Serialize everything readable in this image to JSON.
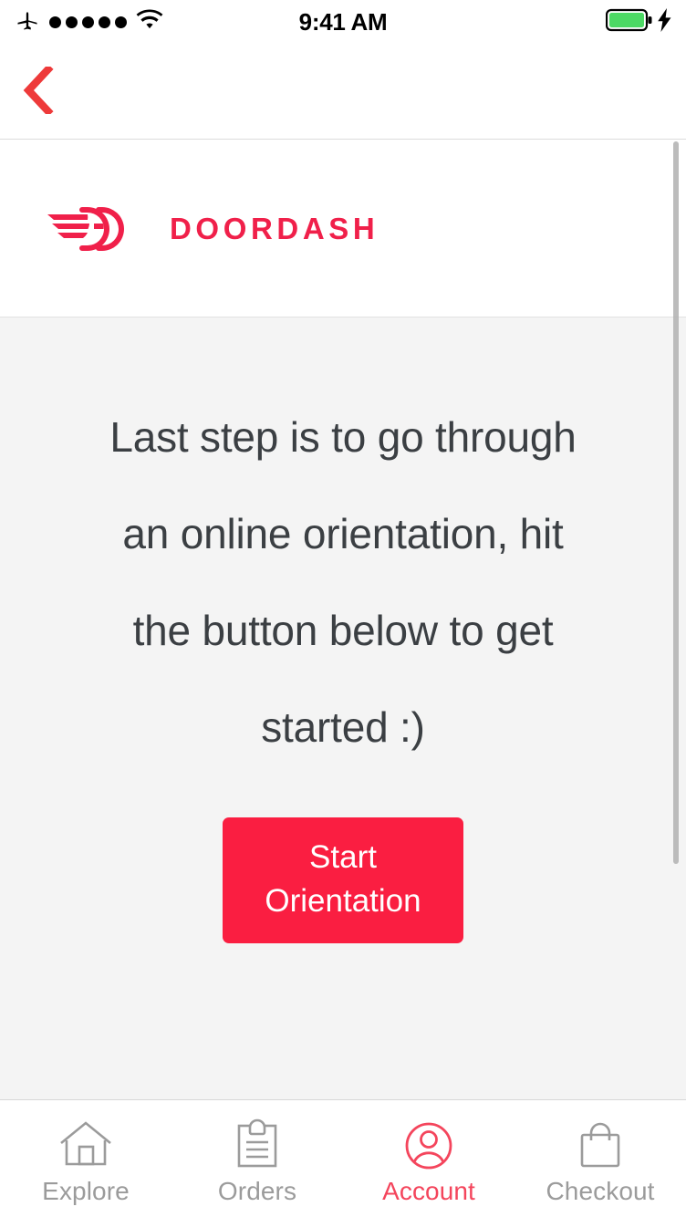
{
  "status_bar": {
    "airplane_icon": "airplane-mode-icon",
    "signal_dots": 5,
    "wifi_icon": "wifi-icon",
    "time": "9:41 AM",
    "battery_icon": "battery-full-icon",
    "battery_level_percent": 100,
    "charging_icon": "charging-bolt-icon",
    "battery_color": "#4CD964"
  },
  "nav_bar": {
    "back_icon": "back-chevron-icon",
    "back_color": "#EE3A3A"
  },
  "header": {
    "logo_mark": "doordash-dash-logo-icon",
    "wordmark": "DOORDASH",
    "brand_color": "#F0204A"
  },
  "main": {
    "body_text": "Last step is to go through an online orientation, hit the button below to get started :)",
    "cta": {
      "label_line1": "Start",
      "label_line2": "Orientation",
      "background_color": "#FA1E41",
      "text_color": "#FFFFFF"
    },
    "background_color": "#F4F4F4",
    "scrollbar": "vertical-scrollbar"
  },
  "tab_bar": {
    "active_color": "#F4455C",
    "inactive_color": "#9B9B9B",
    "tabs": [
      {
        "label": "Explore",
        "icon": "home-icon",
        "active": false
      },
      {
        "label": "Orders",
        "icon": "clipboard-icon",
        "active": false
      },
      {
        "label": "Account",
        "icon": "account-circle-icon",
        "active": true
      },
      {
        "label": "Checkout",
        "icon": "shopping-bag-icon",
        "active": false
      }
    ]
  }
}
